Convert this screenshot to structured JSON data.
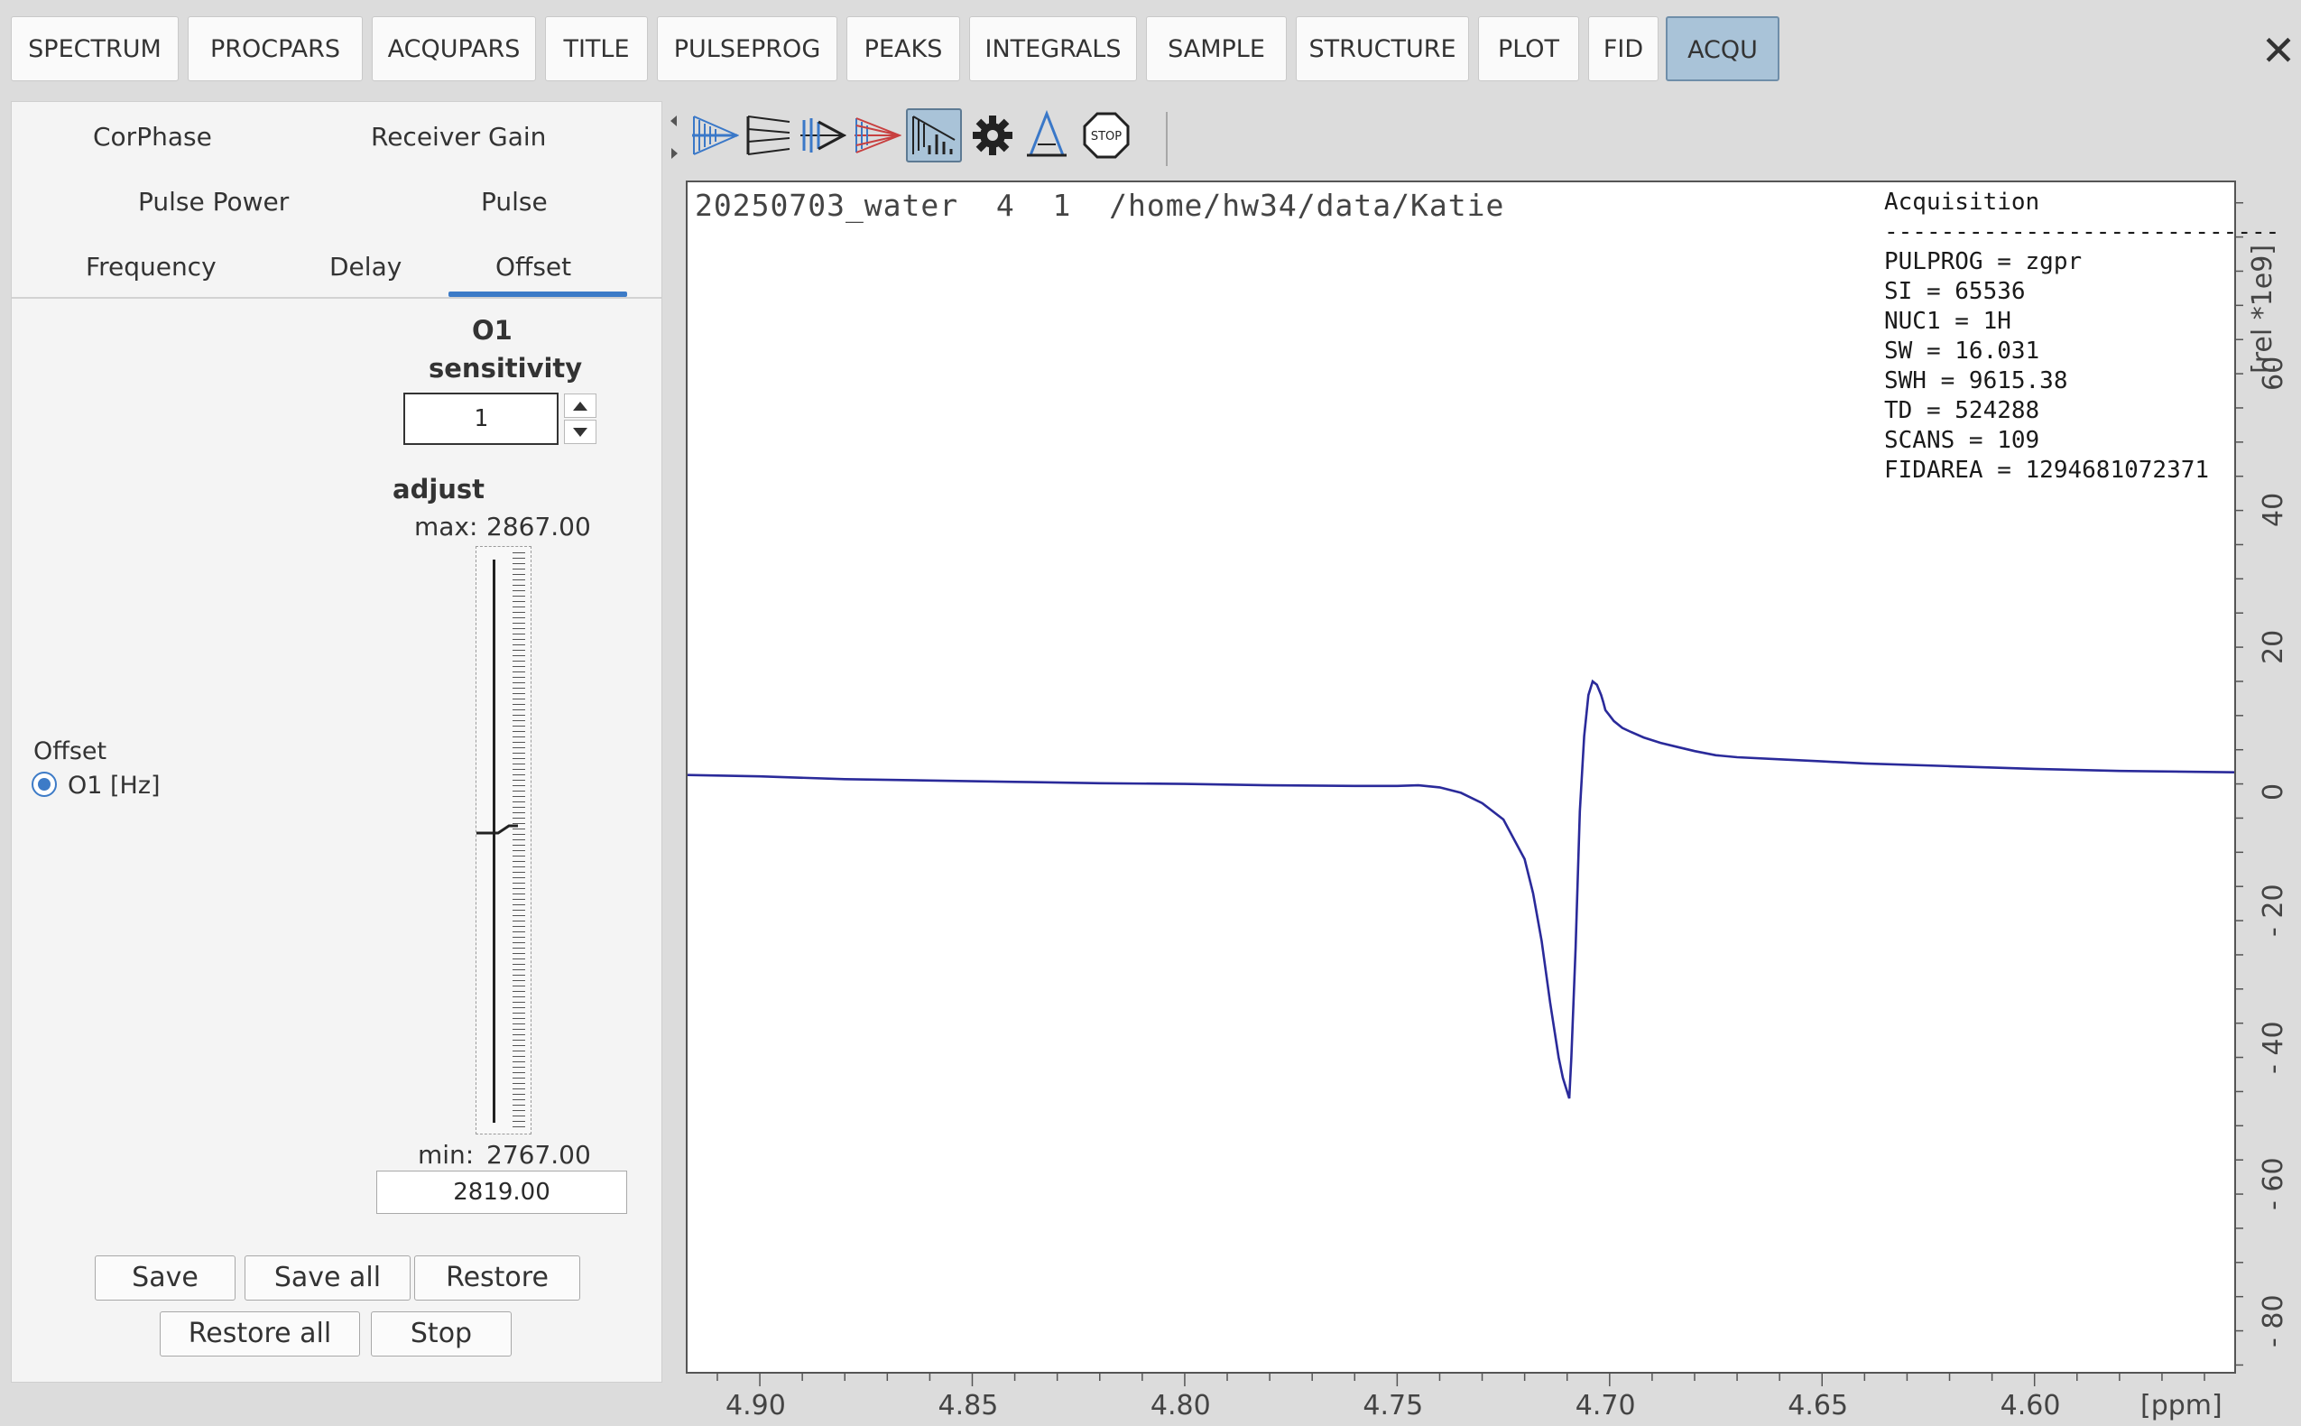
{
  "top_tabs": [
    {
      "label": "SPECTRUM",
      "active": false
    },
    {
      "label": "PROCPARS",
      "active": false
    },
    {
      "label": "ACQUPARS",
      "active": false
    },
    {
      "label": "TITLE",
      "active": false
    },
    {
      "label": "PULSEPROG",
      "active": false
    },
    {
      "label": "PEAKS",
      "active": false
    },
    {
      "label": "INTEGRALS",
      "active": false
    },
    {
      "label": "SAMPLE",
      "active": false
    },
    {
      "label": "STRUCTURE",
      "active": false
    },
    {
      "label": "PLOT",
      "active": false
    },
    {
      "label": "FID",
      "active": false
    },
    {
      "label": "ACQU",
      "active": true
    }
  ],
  "close_label": "✕",
  "panel": {
    "tabs": {
      "corphase": "CorPhase",
      "receiver_gain": "Receiver Gain",
      "pulse_power": "Pulse Power",
      "pulse": "Pulse",
      "frequency": "Frequency",
      "delay": "Delay",
      "offset": "Offset"
    },
    "active_tab": "Offset",
    "param_name": "O1",
    "sensitivity_label": "sensitivity",
    "sensitivity_value": "1",
    "adjust_label": "adjust",
    "max_label": "max:",
    "max_value": "2867.00",
    "min_label": "min:",
    "min_value": "2767.00",
    "current_value": "2819.00",
    "slider_fraction": 0.52,
    "group_label": "Offset",
    "radio_label": "O1  [Hz]",
    "buttons": {
      "save": "Save",
      "save_all": "Save all",
      "restore": "Restore",
      "restore_all": "Restore all",
      "stop": "Stop"
    }
  },
  "toolbar_icons": [
    "fid-blue-icon",
    "fid-black-icon",
    "fid-multi-icon",
    "fid-red-icon",
    "spectrum-fid-icon",
    "gear-icon",
    "pulse-icon",
    "stop-icon"
  ],
  "spectrum": {
    "title": "20250703_water  4  1  /home/hw34/data/Katie",
    "acq_heading": "Acquisition",
    "acq_separator": "----------------------------",
    "acq_params": [
      "PULPROG = zgpr",
      "SI = 65536",
      "NUC1 = 1H",
      "SW = 16.031",
      "SWH = 9615.38",
      "TD = 524288",
      "SCANS = 109",
      "FIDAREA = 1294681072371"
    ]
  },
  "chart_data": {
    "type": "line",
    "xlabel": "[ppm]",
    "ylabel": "[rel *1e9]",
    "xlim": [
      4.917,
      4.553
    ],
    "ylim": [
      -87,
      87
    ],
    "x_ticks": [
      4.9,
      4.85,
      4.8,
      4.75,
      4.7,
      4.65,
      4.6
    ],
    "x_tick_labels": [
      "4.90",
      "4.85",
      "4.80",
      "4.75",
      "4.70",
      "4.65",
      "4.60"
    ],
    "y_ticks": [
      60,
      40,
      20,
      0,
      -20,
      -40,
      -60,
      -80
    ],
    "y_tick_labels": [
      "60",
      "40",
      "20",
      "0",
      "- 20",
      "- 40",
      "- 60",
      "- 80"
    ],
    "series": [
      {
        "color": "#2a2a9a",
        "x": [
          4.917,
          4.9,
          4.88,
          4.86,
          4.84,
          4.82,
          4.8,
          4.78,
          4.76,
          4.75,
          4.745,
          4.74,
          4.735,
          4.73,
          4.725,
          4.72,
          4.718,
          4.716,
          4.714,
          4.712,
          4.711,
          4.71,
          4.7095,
          4.709,
          4.708,
          4.707,
          4.706,
          4.705,
          4.704,
          4.703,
          4.702,
          4.7015,
          4.701,
          4.7,
          4.699,
          4.697,
          4.695,
          4.692,
          4.688,
          4.684,
          4.68,
          4.675,
          4.67,
          4.66,
          4.65,
          4.64,
          4.62,
          4.6,
          4.58,
          4.553
        ],
        "y": [
          0.3,
          0.1,
          -0.3,
          -0.5,
          -0.7,
          -0.9,
          -1.0,
          -1.2,
          -1.3,
          -1.3,
          -1.2,
          -1.5,
          -2.3,
          -3.8,
          -6.2,
          -12,
          -17,
          -24,
          -33,
          -41,
          -44,
          -46,
          -47,
          -41,
          -25,
          -5,
          6,
          12,
          14,
          13.5,
          12,
          11,
          9.8,
          9,
          8.2,
          7.2,
          6.6,
          5.8,
          5,
          4.4,
          3.8,
          3.2,
          2.9,
          2.6,
          2.3,
          2.0,
          1.6,
          1.2,
          0.9,
          0.7
        ]
      }
    ]
  }
}
